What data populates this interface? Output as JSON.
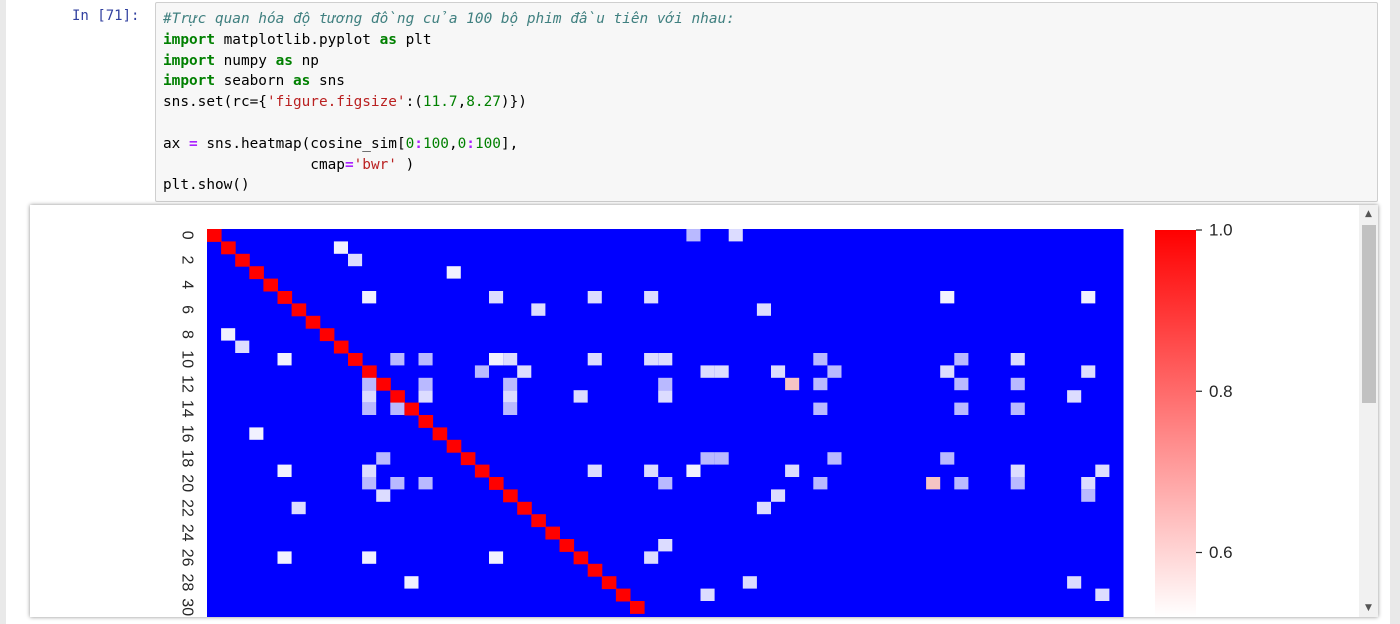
{
  "cell": {
    "prompt": "In [71]:",
    "code": {
      "comment": "#Trực quan hóa độ tương đồng của 100 bộ phim đầu tiên với nhau:",
      "kw_import": "import",
      "kw_as": "as",
      "mod_pyplot": " matplotlib.pyplot ",
      "alias_plt": " plt",
      "mod_numpy": " numpy ",
      "alias_np": " np",
      "mod_seaborn": " seaborn ",
      "alias_sns": " sns",
      "set_open": "sns.set(rc={",
      "figsize_key": "'figure.figsize'",
      "colon_paren": ":(",
      "fig_w": "11.7",
      "comma": ",",
      "fig_h": "8.27",
      "set_close": ")})",
      "ax_var": "ax ",
      "eq": "=",
      "heatmap_call": " sns.heatmap(cosine_sim[",
      "n0a": "0",
      "colon1": ":",
      "n100a": "100",
      "comma2": ",",
      "n0b": "0",
      "colon2": ":",
      "n100b": "100",
      "bracket_close": "],",
      "cmap_indent": "                 cmap",
      "eq2": "=",
      "cmap_val": "'bwr'",
      "paren_close": " )",
      "show": "plt.show()"
    }
  },
  "chart_data": {
    "type": "heatmap",
    "title": "",
    "colormap": "bwr",
    "colors": {
      "low": "#0000ff",
      "mid": "#ffffff",
      "high": "#ff0000"
    },
    "visible_rows": 31,
    "visible_cols": 65,
    "y_tick_labels": [
      "0",
      "2",
      "4",
      "6",
      "8",
      "10",
      "12",
      "14",
      "16",
      "18",
      "20",
      "22",
      "24",
      "26",
      "28",
      "30"
    ],
    "colorbar": {
      "ticks": [
        "1.0",
        "0.8",
        "0.6"
      ],
      "range": [
        0.52,
        1.0
      ]
    },
    "diagonal_value": 1.0,
    "background_value": 0.0,
    "cells": [
      [
        0,
        34,
        0.58
      ],
      [
        0,
        37,
        0.6
      ],
      [
        1,
        9,
        0.62
      ],
      [
        2,
        10,
        0.6
      ],
      [
        3,
        17,
        0.62
      ],
      [
        5,
        11,
        0.65
      ],
      [
        5,
        20,
        0.6
      ],
      [
        5,
        27,
        0.6
      ],
      [
        5,
        31,
        0.6
      ],
      [
        5,
        52,
        0.65
      ],
      [
        5,
        62,
        0.65
      ],
      [
        6,
        23,
        0.6
      ],
      [
        6,
        39,
        0.6
      ],
      [
        8,
        1,
        0.62
      ],
      [
        9,
        2,
        0.6
      ],
      [
        10,
        5,
        0.65
      ],
      [
        10,
        13,
        0.55
      ],
      [
        10,
        15,
        0.55
      ],
      [
        10,
        20,
        0.65
      ],
      [
        10,
        21,
        0.6
      ],
      [
        10,
        27,
        0.6
      ],
      [
        10,
        31,
        0.6
      ],
      [
        10,
        32,
        0.6
      ],
      [
        10,
        43,
        0.55
      ],
      [
        10,
        53,
        0.55
      ],
      [
        10,
        57,
        0.6
      ],
      [
        11,
        19,
        0.55
      ],
      [
        11,
        22,
        0.6
      ],
      [
        11,
        35,
        0.6
      ],
      [
        11,
        36,
        0.6
      ],
      [
        11,
        40,
        0.6
      ],
      [
        11,
        44,
        0.55
      ],
      [
        11,
        52,
        0.6
      ],
      [
        11,
        62,
        0.6
      ],
      [
        12,
        11,
        0.55
      ],
      [
        12,
        15,
        0.55
      ],
      [
        12,
        21,
        0.55
      ],
      [
        12,
        32,
        0.55
      ],
      [
        12,
        41,
        0.8
      ],
      [
        12,
        43,
        0.55
      ],
      [
        12,
        53,
        0.55
      ],
      [
        12,
        57,
        0.55
      ],
      [
        13,
        11,
        0.6
      ],
      [
        13,
        15,
        0.6
      ],
      [
        13,
        21,
        0.6
      ],
      [
        13,
        26,
        0.6
      ],
      [
        13,
        32,
        0.6
      ],
      [
        13,
        61,
        0.6
      ],
      [
        14,
        11,
        0.55
      ],
      [
        14,
        13,
        0.55
      ],
      [
        14,
        21,
        0.55
      ],
      [
        14,
        43,
        0.55
      ],
      [
        14,
        53,
        0.55
      ],
      [
        14,
        57,
        0.55
      ],
      [
        16,
        3,
        0.62
      ],
      [
        18,
        12,
        0.55
      ],
      [
        18,
        35,
        0.55
      ],
      [
        18,
        36,
        0.55
      ],
      [
        18,
        44,
        0.55
      ],
      [
        18,
        52,
        0.55
      ],
      [
        19,
        5,
        0.62
      ],
      [
        19,
        11,
        0.6
      ],
      [
        19,
        27,
        0.6
      ],
      [
        19,
        31,
        0.6
      ],
      [
        19,
        34,
        0.62
      ],
      [
        19,
        41,
        0.6
      ],
      [
        19,
        57,
        0.6
      ],
      [
        19,
        63,
        0.6
      ],
      [
        20,
        11,
        0.55
      ],
      [
        20,
        13,
        0.55
      ],
      [
        20,
        15,
        0.55
      ],
      [
        20,
        32,
        0.55
      ],
      [
        20,
        43,
        0.55
      ],
      [
        20,
        51,
        0.8
      ],
      [
        20,
        53,
        0.55
      ],
      [
        20,
        57,
        0.55
      ],
      [
        20,
        62,
        0.6
      ],
      [
        21,
        12,
        0.6
      ],
      [
        21,
        40,
        0.6
      ],
      [
        21,
        62,
        0.55
      ],
      [
        22,
        6,
        0.6
      ],
      [
        22,
        39,
        0.6
      ],
      [
        25,
        32,
        0.6
      ],
      [
        26,
        5,
        0.62
      ],
      [
        26,
        11,
        0.62
      ],
      [
        26,
        20,
        0.62
      ],
      [
        26,
        31,
        0.6
      ],
      [
        28,
        14,
        0.62
      ],
      [
        28,
        38,
        0.6
      ],
      [
        28,
        61,
        0.6
      ],
      [
        29,
        35,
        0.6
      ],
      [
        29,
        63,
        0.6
      ]
    ]
  }
}
